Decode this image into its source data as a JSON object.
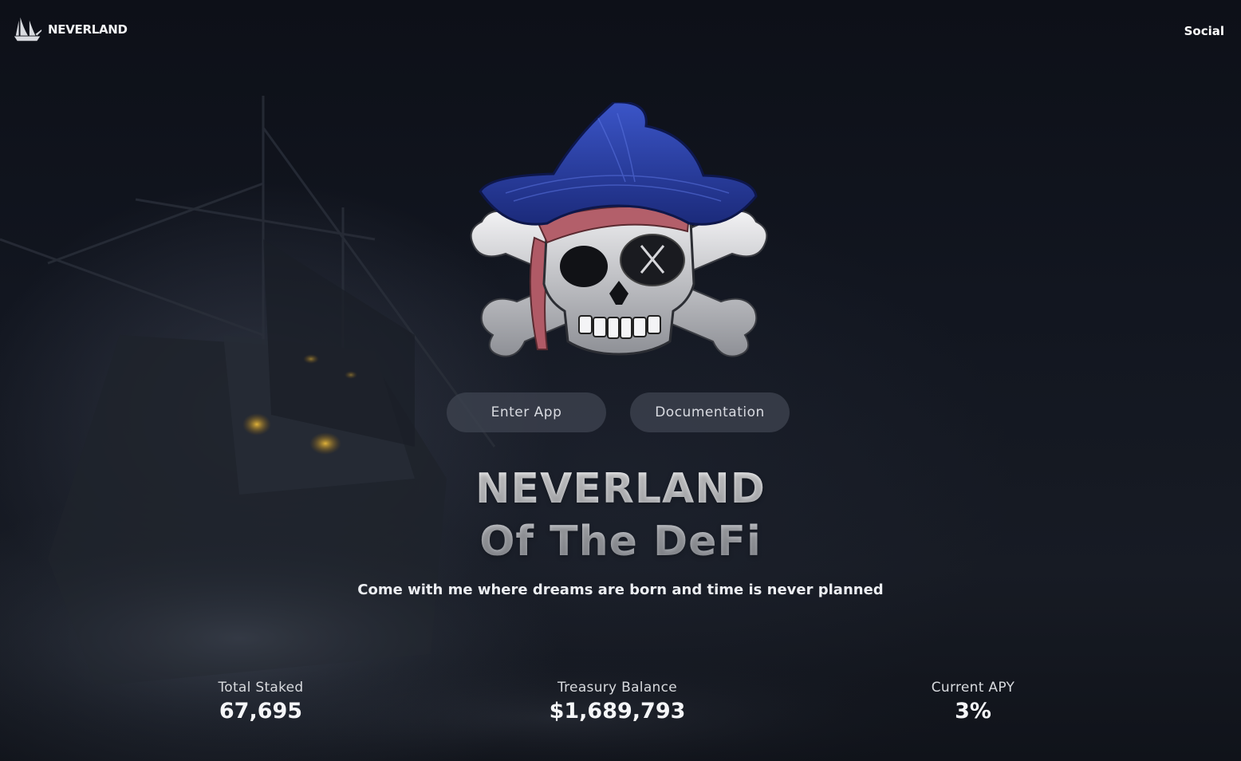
{
  "header": {
    "brand": "NEVERLAND",
    "nav": {
      "social_label": "Social"
    }
  },
  "hero": {
    "emblem_icon": "pirate-skull-crossbones-icon",
    "buttons": {
      "enter_app": "Enter App",
      "documentation": "Documentation"
    },
    "title_line1": "NEVERLAND",
    "title_line2": "Of The DeFi",
    "subtitle": "Come with me where dreams are born and time is never planned"
  },
  "stats": [
    {
      "label": "Total Staked",
      "value": "67,695"
    },
    {
      "label": "Treasury Balance",
      "value": "$1,689,793"
    },
    {
      "label": "Current APY",
      "value": "3%"
    }
  ],
  "colors": {
    "background": "#0c0f16",
    "hat_blue": "#2a3fa0",
    "button_bg": "#3e4350",
    "text_primary": "#ffffff"
  }
}
